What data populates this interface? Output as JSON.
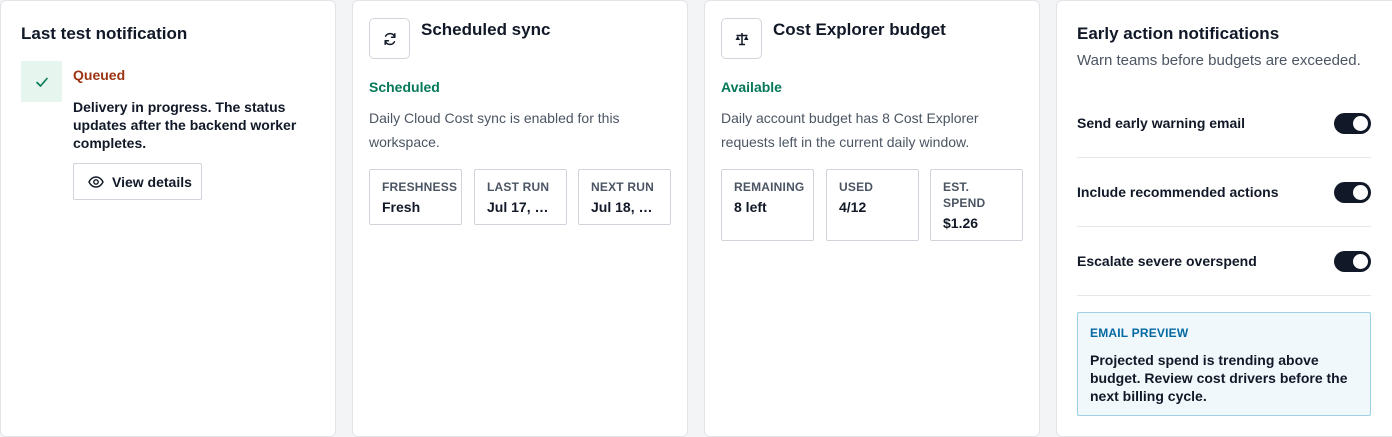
{
  "last_test": {
    "title": "Last test notification",
    "status": "Queued",
    "message": "Delivery in progress. The status updates after the backend worker completes.",
    "view_button": "View details",
    "icon": "check-icon"
  },
  "scheduled_sync": {
    "title": "Scheduled sync",
    "icon": "refresh-icon",
    "status": "Scheduled",
    "description": "Daily Cloud Cost sync is enabled for this workspace.",
    "stats": [
      {
        "label": "FRESHNESS",
        "value": "Fresh"
      },
      {
        "label": "LAST RUN",
        "value": "Jul 17, 9…"
      },
      {
        "label": "NEXT RUN",
        "value": "Jul 18, 9…"
      }
    ]
  },
  "cost_explorer": {
    "title": "Cost Explorer budget",
    "icon": "scale-icon",
    "status": "Available",
    "description": "Daily account budget has 8 Cost Explorer requests left in the current daily window.",
    "stats": [
      {
        "label": "REMAINING",
        "value": "8 left"
      },
      {
        "label": "USED",
        "value": "4/12"
      },
      {
        "label": "EST. SPEND",
        "value": "$1.26"
      }
    ]
  },
  "early_action": {
    "title": "Early action notifications",
    "subtitle": "Warn teams before budgets are exceeded.",
    "toggles": [
      {
        "label": "Send early warning email",
        "on": true
      },
      {
        "label": "Include recommended actions",
        "on": true
      },
      {
        "label": "Escalate severe overspend",
        "on": true
      }
    ],
    "preview_label": "EMAIL PREVIEW",
    "preview_text": "Projected spend is trending above budget. Review cost drivers before the next billing cycle."
  },
  "colors": {
    "queued": "#9a3412",
    "status_green": "#047857",
    "preview_accent": "#0369a1",
    "toggle_on": "#111827"
  }
}
